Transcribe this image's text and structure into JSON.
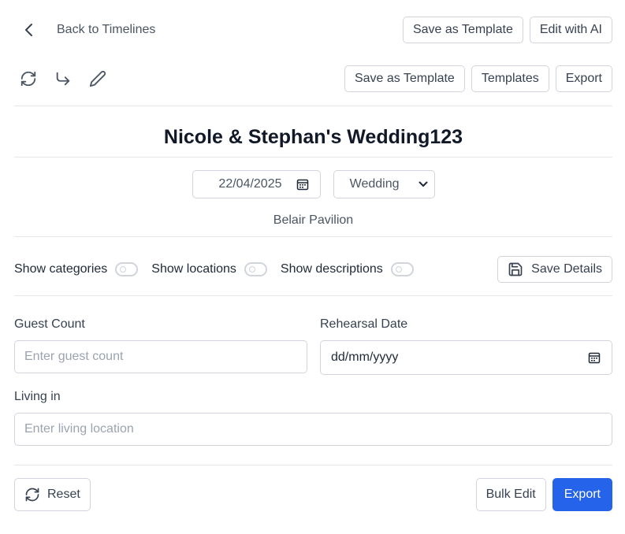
{
  "nav": {
    "back_label": "Back to Timelines"
  },
  "header_actions": {
    "save_template": "Save as Template",
    "edit_ai": "Edit with AI"
  },
  "toolbar": {
    "save_template": "Save as Template",
    "templates": "Templates",
    "export": "Export"
  },
  "icons": {
    "back": "chevron-left-icon",
    "refresh": "refresh-icon",
    "redo": "redo-arrow-icon",
    "edit": "pencil-icon",
    "calendar": "calendar-icon",
    "chevron": "chevron-down-icon",
    "save": "floppy-disk-icon",
    "reset": "refresh-icon"
  },
  "event": {
    "title": "Nicole & Stephan's Wedding123",
    "date": "22/04/2025",
    "type": "Wedding",
    "venue": "Belair Pavilion"
  },
  "toggles": {
    "show_categories": "Show categories",
    "show_locations": "Show locations",
    "show_descriptions": "Show descriptions",
    "save_details": "Save Details",
    "states": {
      "categories": false,
      "locations": false,
      "descriptions": false
    }
  },
  "form": {
    "guest_count": {
      "label": "Guest Count",
      "placeholder": "Enter guest count",
      "value": ""
    },
    "rehearsal_date": {
      "label": "Rehearsal Date",
      "value": "dd/mm/yyyy"
    },
    "living_in": {
      "label": "Living in",
      "placeholder": "Enter living location",
      "value": ""
    }
  },
  "footer": {
    "reset": "Reset",
    "bulk_edit": "Bulk Edit",
    "export": "Export"
  },
  "colors": {
    "primary": "#2563eb",
    "border": "#d1d5db",
    "divider": "#e5e7eb",
    "title": "#111827"
  }
}
